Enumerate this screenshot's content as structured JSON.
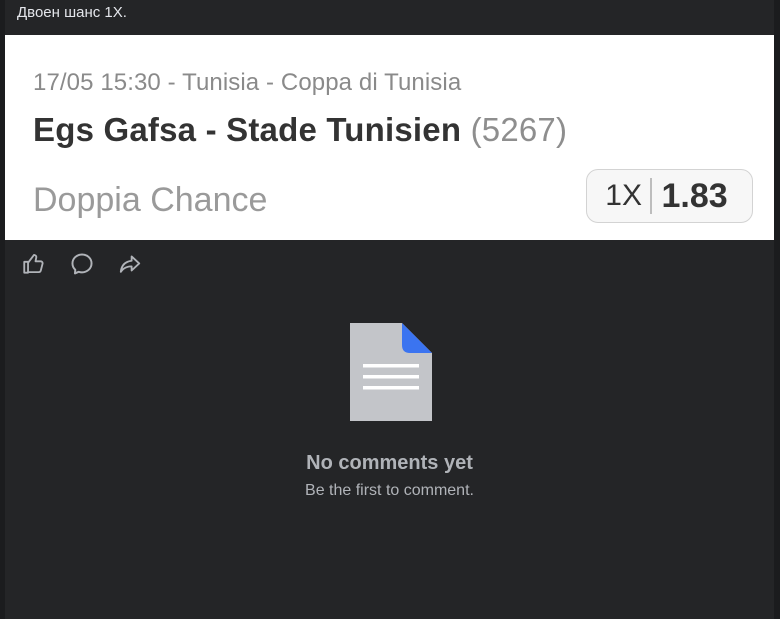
{
  "post": {
    "text": "Двоен шанс 1X."
  },
  "bet_card": {
    "meta": "17/05 15:30 - Tunisia - Coppa di Tunisia",
    "match": "Egs Gafsa - Stade Tunisien",
    "match_id": "(5267)",
    "market": "Doppia Chance",
    "selection": "1X",
    "odds": "1.83"
  },
  "actions": {
    "icons": [
      "thumbs-up-icon",
      "comment-icon",
      "share-icon"
    ]
  },
  "comments": {
    "empty_title": "No comments yet",
    "empty_subtitle": "Be the first to comment.",
    "icon": "document-icon"
  },
  "colors": {
    "panel_bg": "#242527",
    "card_bg": "#ffffff",
    "doc_icon_body": "#c3c5c9",
    "doc_icon_corner": "#3b74f0",
    "muted_text": "#b0b3b8"
  }
}
